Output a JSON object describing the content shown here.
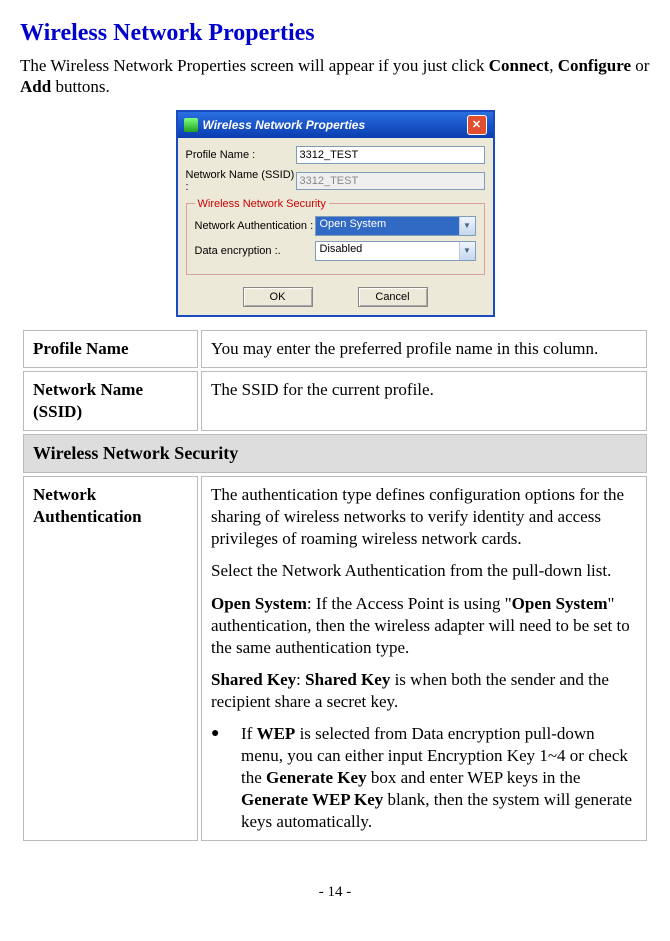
{
  "heading": "Wireless Network Properties",
  "intro": {
    "prefix": "The Wireless Network Properties screen will appear if you just click ",
    "b1": "Connect",
    "sep1": ", ",
    "b2": "Configure",
    "sep2": " or ",
    "b3": "Add",
    "suffix": " buttons."
  },
  "dialog": {
    "title": "Wireless Network Properties",
    "profile_label": "Profile Name :",
    "profile_value": "3312_TEST",
    "ssid_label": "Network Name (SSID) :",
    "ssid_value": "3312_TEST",
    "security_legend": "Wireless Network Security",
    "auth_label": "Network Authentication :",
    "auth_value": "Open System",
    "enc_label": "Data encryption :.",
    "enc_value": "Disabled",
    "ok": "OK",
    "cancel": "Cancel"
  },
  "table": {
    "profile_name": "Profile Name",
    "profile_desc": "You may enter the preferred profile name in this column.",
    "ssid_name": "Network Name (SSID)",
    "ssid_desc": "The SSID for the current profile.",
    "section_header": "Wireless Network Security",
    "auth_name": "Network Authentication",
    "auth_p1": "The authentication type defines configuration options for the sharing of wireless networks to verify identity and access privileges of roaming wireless network cards.",
    "auth_p2": "Select the Network Authentication from the pull-down list.",
    "auth_p3_b1": "Open System",
    "auth_p3_t1": ": If the Access Point is using \"",
    "auth_p3_b2": "Open System",
    "auth_p3_t2": "\" authentication, then the wireless adapter will need to be set to the same authentication type.",
    "auth_p4_b1": "Shared Key",
    "auth_p4_t1": ": ",
    "auth_p4_b2": "Shared Key",
    "auth_p4_t2": " is when both the sender and the recipient share a secret key.",
    "bullet_t1": "If ",
    "bullet_b1": "WEP",
    "bullet_t2": " is selected from Data encryption pull-down menu, you can either input Encryption Key 1~4 or check the ",
    "bullet_b2": "Generate Key",
    "bullet_t3": " box and enter WEP keys in the ",
    "bullet_b3": "Generate WEP Key",
    "bullet_t4": " blank, then the system will generate keys automatically."
  },
  "page_num": "- 14 -"
}
